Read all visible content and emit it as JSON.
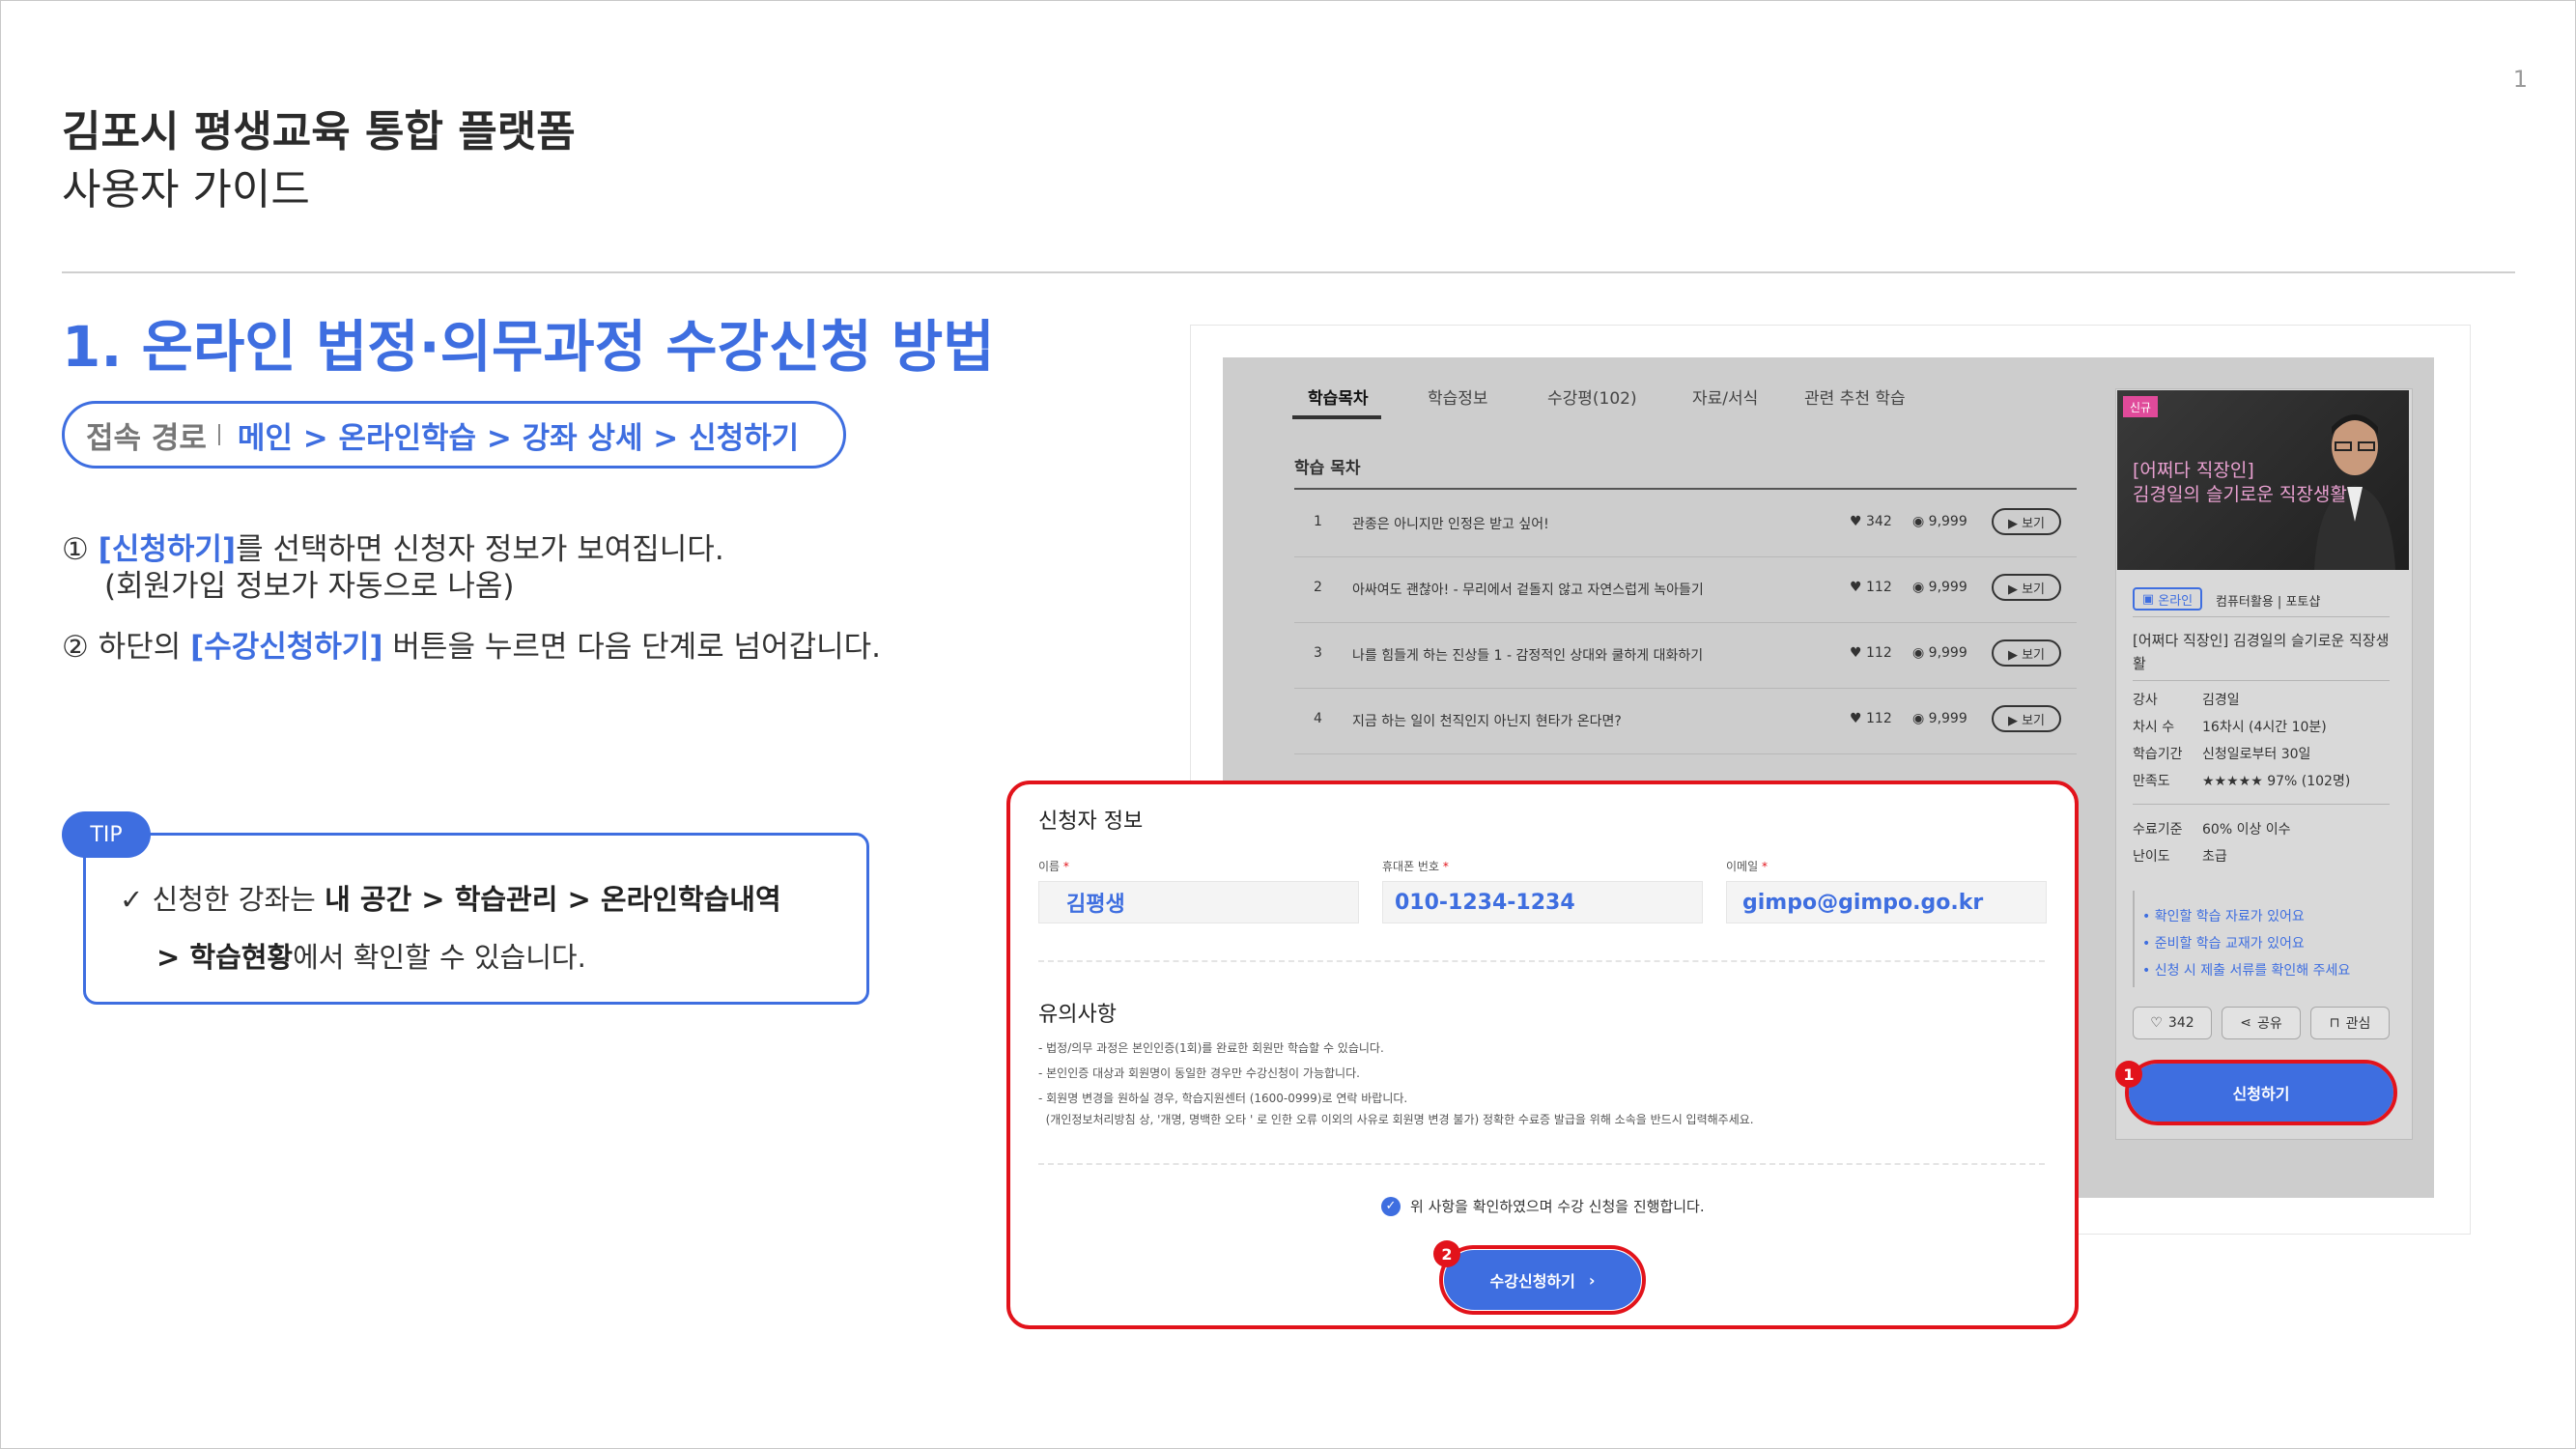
{
  "page": {
    "number": "1"
  },
  "header": {
    "title": "김포시 평생교육 통합 플랫폼",
    "subtitle": "사용자 가이드"
  },
  "section": {
    "title": "1. 온라인 법정·의무과정 수강신청 방법"
  },
  "route": {
    "label": "접속 경로",
    "path": "메인 > 온라인학습 > 강좌 상세 > 신청하기"
  },
  "steps": [
    {
      "marker": "①",
      "highlight": "[신청하기]",
      "text": "를 선택하면 신청자 정보가 보여집니다.",
      "sub": "(회원가입 정보가 자동으로 나옴)"
    },
    {
      "marker": "②",
      "pre": "하단의 ",
      "highlight": "[수강신청하기]",
      "text": " 버튼을 누르면 다음 단계로 넘어갑니다."
    }
  ],
  "tip": {
    "badge": "TIP",
    "check": "✓",
    "line1_pre": "신청한 강좌는 ",
    "line1_bold": "내 공간 > 학습관리 > 온라인학습내역",
    "line2_bold": "> 학습현황",
    "line2_post": "에서 확인할 수 있습니다."
  },
  "screenshot": {
    "tabs": [
      "학습목차",
      "학습정보",
      "수강평(102)",
      "자료/서식",
      "관련 추천 학습"
    ],
    "toc_title": "학습 목차",
    "rows": [
      {
        "no": "1",
        "title": "관종은 아니지만 인정은 받고 싶어!",
        "likes": "♥ 342",
        "views": "◉ 9,999",
        "button": "▶ 보기"
      },
      {
        "no": "2",
        "title": "아싸여도 괜찮아! - 무리에서 겉돌지 않고 자연스럽게 녹아들기",
        "likes": "♥ 112",
        "views": "◉ 9,999",
        "button": "▶ 보기"
      },
      {
        "no": "3",
        "title": "나를 힘들게 하는 진상들 1 - 감정적인 상대와 쿨하게 대화하기",
        "likes": "♥ 112",
        "views": "◉ 9,999",
        "button": "▶ 보기"
      },
      {
        "no": "4",
        "title": "지금 하는 일이 천직인지 아닌지 현타가 온다면?",
        "likes": "♥ 112",
        "views": "◉ 9,999",
        "button": "▶ 보기"
      }
    ],
    "course": {
      "badge": "신규",
      "thumb_line1": "[어쩌다 직장인]",
      "thumb_line2": "김경일의 슬기로운 직장생활",
      "tag": "온라인",
      "categories": "컴퓨터활용 | 포토샵",
      "title_line1": "[어쩌다 직장인] 김경일의 슬기로운 직장생",
      "title_line2": "활",
      "info": [
        {
          "label": "강사",
          "value": "김경일"
        },
        {
          "label": "차시 수",
          "value": "16차시 (4시간 10분)"
        },
        {
          "label": "학습기간",
          "value": "신청일로부터 30일"
        },
        {
          "label": "만족도",
          "value": "★★★★★ 97% (102명)"
        }
      ],
      "info2": [
        {
          "label": "수료기준",
          "value": "60% 이상 이수"
        },
        {
          "label": "난이도",
          "value": "초급"
        }
      ],
      "bullets": [
        "• 확인할 학습 자료가 있어요",
        "• 준비할 학습 교재가 있어요",
        "• 신청 시 제출 서류를 확인해 주세요"
      ],
      "actions": [
        {
          "label": "342",
          "icon": "♡"
        },
        {
          "label": "공유",
          "icon": "⋖"
        },
        {
          "label": "관심",
          "icon": "⊓"
        }
      ],
      "apply_button": "신청하기",
      "marker": "1"
    }
  },
  "popup": {
    "title": "신청자 정보",
    "fields": [
      {
        "label": "이름",
        "value": "김평생"
      },
      {
        "label": "휴대폰 번호",
        "value": "010-1234-1234"
      },
      {
        "label": "이메일",
        "value": "gimpo@gimpo.go.kr"
      }
    ],
    "required_mark": "*",
    "notice_title": "유의사항",
    "notices": [
      "- 법정/의무 과정은 본인인증(1회)를 완료한 회원만 학습할 수 있습니다.",
      "- 본인인증 대상과 회원명이 동일한 경우만 수강신청이 가능합니다.",
      "- 회원명 변경을 원하실 경우, 학습지원센터 (1600-0999)로 연락 바랍니다.",
      "  (개인정보처리방침 상, '개명, 명백한 오타 ' 로 인한 오류 이외의 사유로 회원명 변경 불가) 정확한 수료증 발급을 위해 소속을 반드시 입력해주세요."
    ],
    "agree_text": "위 사항을 확인하였으며 수강 신청을 진행합니다.",
    "submit_button": "수강신청하기",
    "submit_chevron": "›",
    "marker": "2"
  },
  "colors": {
    "accent": "#3e6ee0",
    "marker_red": "#e2131b",
    "badge_pink": "#e04a9a"
  }
}
